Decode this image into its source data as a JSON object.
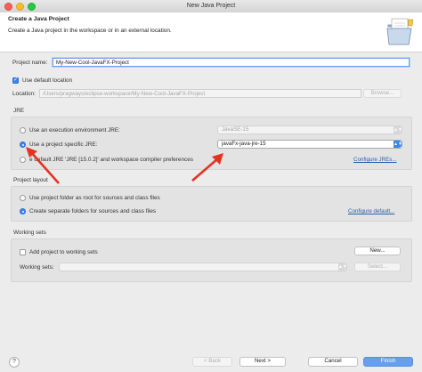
{
  "window": {
    "title": "New Java Project"
  },
  "header": {
    "title": "Create a Java Project",
    "subtitle": "Create a Java project in the workspace or in an external location."
  },
  "project": {
    "name_label": "Project name:",
    "name_value": "My-New-Cool-JavaFX-Project"
  },
  "location": {
    "use_default_label": "Use default location",
    "use_default_checked": true,
    "label": "Location:",
    "value": "/Users/pragways/eclipse-workspace/My-New-Cool-JavaFX-Project",
    "browse_label": "Browse..."
  },
  "jre": {
    "group_label": "JRE",
    "option_env_label": "Use an execution environment JRE:",
    "option_env_value": "JavaSE-15",
    "option_specific_label": "Use a project specific JRE:",
    "option_specific_value": "javaFx-java-jre-15",
    "option_default_prefix": "e",
    "option_default_label": "default JRE 'JRE [15.0.2]' and workspace compiler preferences",
    "configure_label": "Configure JREs..."
  },
  "layout": {
    "group_label": "Project layout",
    "option_root_label": "Use project folder as root for sources and class files",
    "option_separate_label": "Create separate folders for sources and class files",
    "configure_label": "Configure default..."
  },
  "working_sets": {
    "group_label": "Working sets",
    "add_label": "Add project to working sets",
    "new_label": "New...",
    "sets_label": "Working sets:",
    "select_label": "Select..."
  },
  "footer": {
    "help_label": "?",
    "back_label": "< Back",
    "next_label": "Next >",
    "cancel_label": "Cancel",
    "finish_label": "Finish"
  },
  "colors": {
    "accent": "#3b86f0",
    "arrow": "#e53320",
    "link": "#2a5db0"
  }
}
